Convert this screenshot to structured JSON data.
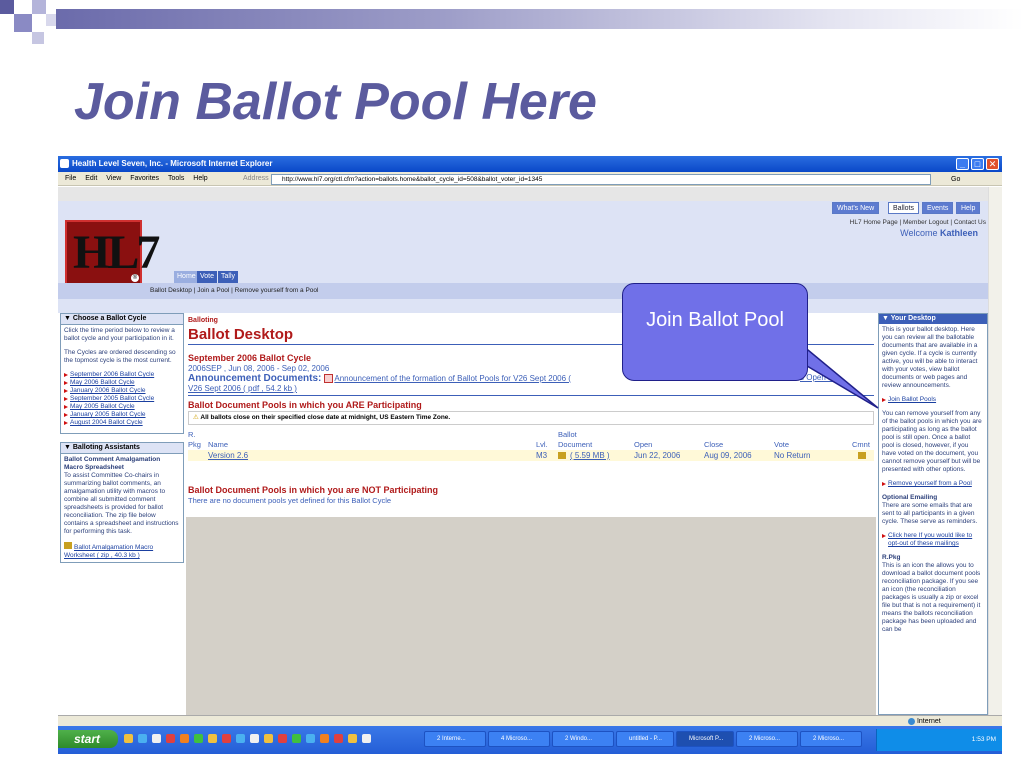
{
  "slide": {
    "title": "Join Ballot Pool Here"
  },
  "browser": {
    "window_title": "Health Level Seven, Inc. - Microsoft Internet Explorer",
    "menu": [
      "File",
      "Edit",
      "View",
      "Favorites",
      "Tools",
      "Help"
    ],
    "address_label": "Address",
    "url": "http://www.hl7.org/ctl.cfm?action=ballots.home&ballot_cycle_id=508&ballot_voter_id=1345",
    "go_label": "Go",
    "status_zone": "Internet"
  },
  "site": {
    "top_tabs": [
      "What's New",
      "Ballots",
      "Events",
      "Help"
    ],
    "top_links": "HL7 Home Page  |  Member Logout  |  Contact Us",
    "welcome_prefix": "Welcome",
    "welcome_name": "Kathleen",
    "logo_text": "HL7",
    "nav_tabs": [
      "Home",
      "Vote",
      "Tally"
    ],
    "subnav": "Ballot Desktop  |  Join a Pool  |  Remove yourself from a Pool"
  },
  "left": {
    "cycle_header": "Choose a Ballot Cycle",
    "cycle_intro": "Click the time period below to review a ballot cycle and your participation in it.",
    "cycle_order": "The Cycles are ordered descending so the topmost cycle is the most current.",
    "cycles": [
      "September 2006 Ballot Cycle",
      "May 2006 Ballot Cycle",
      "January 2006 Ballot Cycle",
      "September 2005 Ballot Cycle",
      "May 2005 Ballot Cycle",
      "January 2005 Ballot Cycle",
      "August 2004 Ballot Cycle"
    ],
    "assist_header": "Balloting Assistants",
    "assist_title": "Ballot Comment Amalgamation Macro Spreadsheet",
    "assist_text": "To assist Committee Co-chairs in summarizing ballot comments, an amalgamation utility with macros to combine all submitted comment spreadsheets is provided for ballot reconciliation. The zip file below contains a spreadsheet and instructions for performing this task.",
    "assist_link": "Ballot Amalgamation Macro Worksheet  ( zip ,  40.3 kb )"
  },
  "main": {
    "crumb": "Balloting",
    "heading": "Ballot Desktop",
    "cycle_title": "September 2006 Ballot Cycle",
    "cycle_dates": "2006SEP ,  Jun 08, 2006 - Sep 02, 2006",
    "announce_label": "Announcement Documents:",
    "announce_link": "Announcement of the formation of Ballot Pools for V26 Sept 2006  (",
    "announce_tail": "s Open for",
    "announce_link2": "V26 Sept 2006  ( pdf ,  54.2 kb )",
    "participating_title": "Ballot Document Pools in which you ARE Participating",
    "notice": "All ballots close on their specified close date at midnight, US Eastern Time Zone.",
    "columns": {
      "rpkg_top": "R.",
      "rpkg": "Pkg",
      "name": "Name",
      "lvl": "Lvl.",
      "doc_top": "Ballot",
      "doc": "Document",
      "open": "Open",
      "close": "Close",
      "vote": "Vote",
      "cmnt": "Cmnt"
    },
    "rows": [
      {
        "name": "Version 2.6",
        "lvl": "M3",
        "doc": "( 5.59 MB )",
        "open": "Jun 22, 2006",
        "close": "Aug 09, 2006",
        "vote": "No Return"
      }
    ],
    "not_participating_title": "Ballot Document Pools in which you are NOT Participating",
    "not_participating_text": "There are no document pools yet defined for this Ballot Cycle"
  },
  "right": {
    "header": "Your Desktop",
    "intro": "This is your ballot desktop. Here you can review all the ballotable documents that are available in a given cycle. If a cycle is currently active, you will be able to interact with your votes, view ballot documents or web pages and review announcements.",
    "join_link": "Join Ballot Pools",
    "remove_text": "You can remove yourself from any of the ballot pools in which you are participating as long as the ballot pool is still open. Once a ballot pool is closed, however, if you have voted on the document, you cannot remove yourself but will be presented with other options.",
    "remove_link": "Remove yourself from a Pool",
    "emailing_title": "Optional Emailing",
    "emailing_text": "There are some emails that are sent to all participants in a given cycle. These serve as reminders.",
    "optout_link": "Click here If you would like to opt-out of these mailings",
    "rpkg_title": "R.Pkg",
    "rpkg_text": "This is an icon the allows you to download a ballot document pools reconciliation package. If you see an icon (the reconciliation packages is usually a zip or excel file but that is not a requirement) it means the ballots reconciliation package has been uploaded and can be"
  },
  "callout": {
    "text": "Join Ballot Pool"
  },
  "taskbar": {
    "start": "start",
    "items": [
      "2 Interne...",
      "4 Microso...",
      "2 Windo...",
      "untitled - P...",
      "Microsoft P...",
      "2 Microso...",
      "2 Microso..."
    ],
    "clock": "1:53 PM"
  },
  "colors": {
    "title": "#5b5b9e",
    "accent_blue": "#3c5fb8",
    "heading_red": "#b01a1a",
    "callout": "#7070e8"
  }
}
